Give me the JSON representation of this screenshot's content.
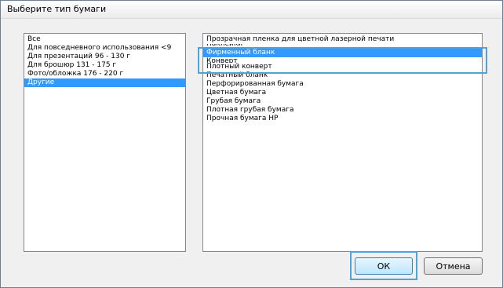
{
  "dialog": {
    "title": "Выберите тип бумаги",
    "ok_label": "ОК",
    "cancel_label": "Отмена"
  },
  "left_list": {
    "selected_index": 5,
    "items": [
      "Все",
      "Для повседневного использования <9",
      "Для презентаций 96 - 130 г",
      "Для брошюр 131 - 175 г",
      "Фото/обложка 176 - 220 г",
      "Другие"
    ]
  },
  "right_list": {
    "selected_index": 2,
    "items": [
      "Прозрачная пленка для цветной лазерной печати",
      "Наклейки",
      "Фирменный бланк",
      "Конверт",
      "Плотный конверт",
      "Печатный бланк",
      "Перфорированная бумага",
      "Цветная бумага",
      "Грубая бумага",
      "Плотная грубая бумага",
      "Прочная бумага HP"
    ]
  },
  "colors": {
    "selection": "#3399ff",
    "highlight_frame": "#4fa3d9"
  }
}
